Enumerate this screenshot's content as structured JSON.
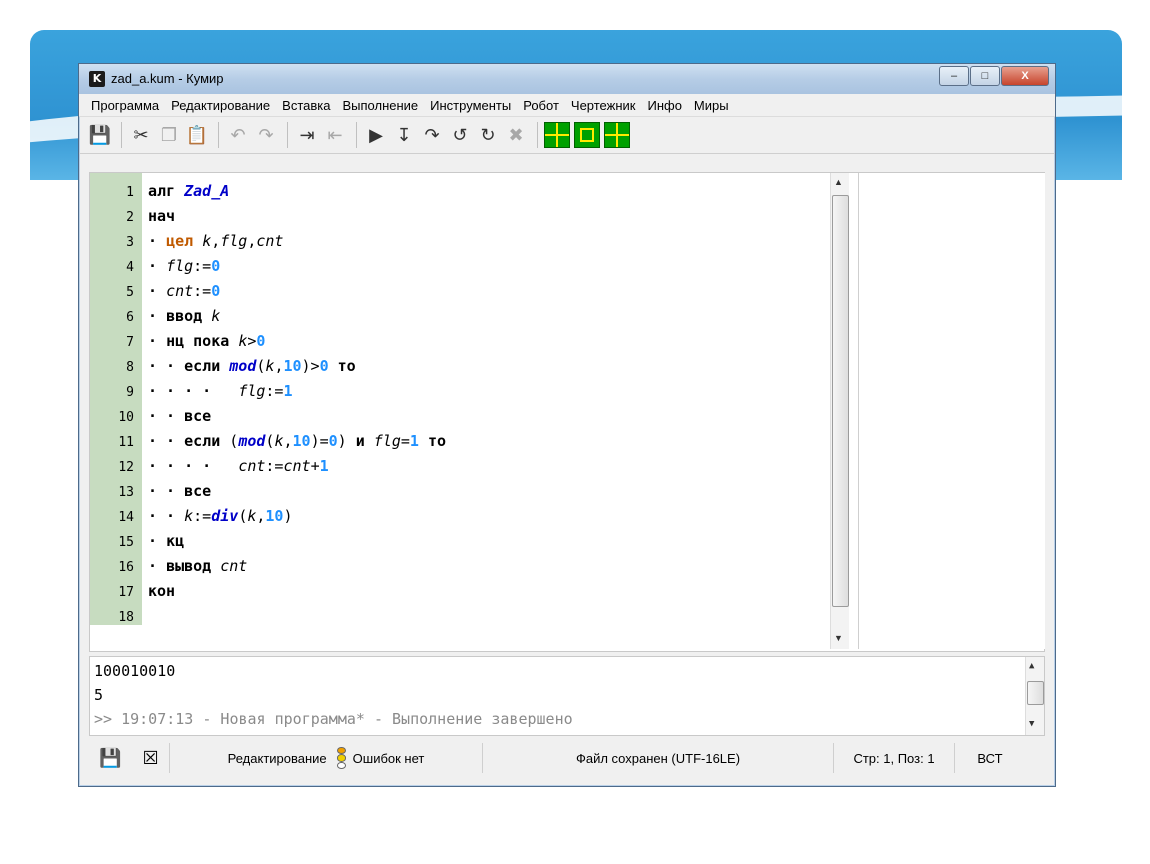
{
  "window": {
    "title": "zad_a.kum - Кумир",
    "app_icon_letter": "K",
    "min": "–",
    "max": "□",
    "close": "X"
  },
  "menu": [
    "Программа",
    "Редактирование",
    "Вставка",
    "Выполнение",
    "Инструменты",
    "Робот",
    "Чертежник",
    "Инфо",
    "Миры"
  ],
  "toolbar": {
    "icons": [
      "save-icon",
      "cut-icon",
      "copy-icon",
      "paste-icon",
      "undo-icon",
      "redo-icon",
      "indent-icon",
      "unindent-icon",
      "run-icon",
      "step-icon",
      "step-in-icon",
      "step-out-icon",
      "step-over-icon",
      "stop-icon",
      "robot-icon",
      "drawer-icon",
      "grid-icon"
    ]
  },
  "editor": {
    "lines": [
      {
        "n": "1",
        "html": "<span class='kw'>алг</span> <span class='fn'>Zad_A</span>"
      },
      {
        "n": "2",
        "html": "<span class='kw'>нач</span>"
      },
      {
        "n": "3",
        "html": "<span class='kw'>·</span> <span class='ty'>цел</span> <span class='vr'>k</span>,<span class='vr'>flg</span>,<span class='vr'>cnt</span>"
      },
      {
        "n": "4",
        "html": "<span class='kw'>·</span> <span class='vr'>flg</span>:=<span class='nm'>0</span>"
      },
      {
        "n": "5",
        "html": "<span class='kw'>·</span> <span class='vr'>cnt</span>:=<span class='nm'>0</span>"
      },
      {
        "n": "6",
        "html": "<span class='kw'>·</span> <span class='kw'>ввод</span> <span class='vr'>k</span>"
      },
      {
        "n": "7",
        "html": "<span class='kw'>·</span> <span class='kw'>нц пока</span> <span class='vr'>k</span>&gt;<span class='nm'>0</span>"
      },
      {
        "n": "8",
        "html": "<span class='kw'>· ·</span> <span class='kw'>если</span> <span class='fn'>mod</span>(<span class='vr'>k</span>,<span class='nm'>10</span>)&gt;<span class='nm'>0</span> <span class='kw'>то</span>"
      },
      {
        "n": "9",
        "html": "<span class='kw'>· · · ·</span>   <span class='vr'>flg</span>:=<span class='nm'>1</span>"
      },
      {
        "n": "10",
        "html": "<span class='kw'>· ·</span> <span class='kw'>все</span>"
      },
      {
        "n": "11",
        "html": "<span class='kw'>· ·</span> <span class='kw'>если</span> (<span class='fn'>mod</span>(<span class='vr'>k</span>,<span class='nm'>10</span>)=<span class='nm'>0</span>) <span class='kw'>и</span> <span class='vr'>flg</span>=<span class='nm'>1</span> <span class='kw'>то</span>"
      },
      {
        "n": "12",
        "html": "<span class='kw'>· · · ·</span>   <span class='vr'>cnt</span>:=<span class='vr'>cnt</span>+<span class='nm'>1</span>"
      },
      {
        "n": "13",
        "html": "<span class='kw'>· ·</span> <span class='kw'>все</span>"
      },
      {
        "n": "14",
        "html": "<span class='kw'>· ·</span> <span class='vr'>k</span>:=<span class='fn'>div</span>(<span class='vr'>k</span>,<span class='nm'>10</span>)"
      },
      {
        "n": "15",
        "html": "<span class='kw'>·</span> <span class='kw'>кц</span>"
      },
      {
        "n": "16",
        "html": "<span class='kw'>·</span> <span class='kw'>вывод</span> <span class='vr'>cnt</span>"
      },
      {
        "n": "17",
        "html": "<span class='kw'>кон</span>"
      },
      {
        "n": "18",
        "html": ""
      }
    ]
  },
  "console": {
    "lines": [
      "100010010",
      "5",
      ">> 19:07:13 - Новая программа* - Выполнение завершено"
    ]
  },
  "status": {
    "mode": "Редактирование",
    "errors": "Ошибок нет",
    "file": "Файл сохранен (UTF-16LE)",
    "position": "Стр: 1, Поз: 1",
    "insert": "ВСТ"
  }
}
